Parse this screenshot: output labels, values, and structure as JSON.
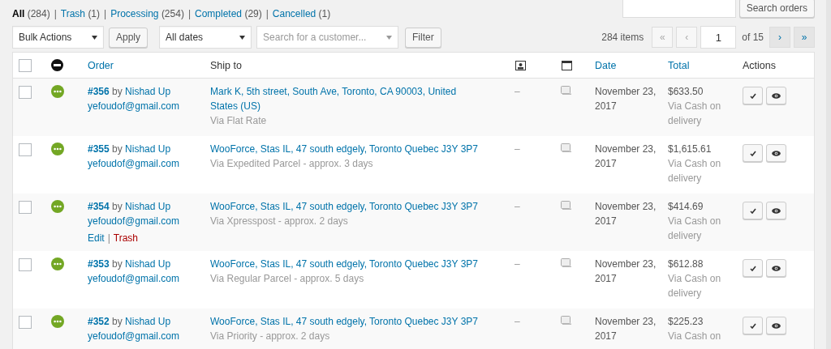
{
  "views": [
    {
      "label": "All",
      "count": "(284)",
      "selected": true
    },
    {
      "label": "Trash",
      "count": "(1)",
      "selected": false
    },
    {
      "label": "Processing",
      "count": "(254)",
      "selected": false
    },
    {
      "label": "Completed",
      "count": "(29)",
      "selected": false
    },
    {
      "label": "Cancelled",
      "count": "(1)",
      "selected": false
    }
  ],
  "view_separator": "|",
  "search": {
    "button": "Search orders"
  },
  "bulk_actions": {
    "value": "Bulk Actions",
    "apply": "Apply"
  },
  "date_filter": {
    "value": "All dates"
  },
  "customer_filter": {
    "placeholder": "Search for a customer..."
  },
  "filter_button": "Filter",
  "pagination": {
    "items": "284 items",
    "first": "«",
    "prev": "‹",
    "page": "1",
    "of": "of 15",
    "next": "›",
    "last": "»",
    "first_disabled": true,
    "prev_disabled": true,
    "next_disabled": false,
    "last_disabled": false
  },
  "table": {
    "select_all_checked": false,
    "columns": [
      {
        "kind": "status-icon"
      },
      {
        "kind": "text",
        "label": "Order",
        "sortable": true
      },
      {
        "kind": "text",
        "label": "Ship to",
        "sortable": false
      },
      {
        "kind": "billing-icon"
      },
      {
        "kind": "notes-icon"
      },
      {
        "kind": "text",
        "label": "Date",
        "sortable": true
      },
      {
        "kind": "text",
        "label": "Total",
        "sortable": true
      },
      {
        "kind": "text",
        "label": "Actions",
        "sortable": false
      }
    ],
    "rows": [
      {
        "checked": false,
        "color": "#73a724",
        "number": "#356",
        "by": "by",
        "customer": "Nishad Up",
        "email": "yefoudof@gmail.com",
        "address": "Mark K, 5th street, South Ave, Toronto, CA 90003, United States (US)",
        "method": "Via Flat Rate",
        "billing": "–",
        "date": "November 23, 2017",
        "total": "$633.50",
        "payment": "Via Cash on delivery",
        "row_actions": []
      },
      {
        "checked": false,
        "color": "#73a724",
        "number": "#355",
        "by": "by",
        "customer": "Nishad Up",
        "email": "yefoudof@gmail.com",
        "address": "WooForce, Stas IL, 47 south edgely, Toronto Quebec J3Y 3P7",
        "method": "Via Expedited Parcel - approx. 3 days",
        "billing": "–",
        "date": "November 23, 2017",
        "total": "$1,615.61",
        "payment": "Via Cash on delivery",
        "row_actions": []
      },
      {
        "checked": false,
        "color": "#73a724",
        "number": "#354",
        "by": "by",
        "customer": "Nishad Up",
        "email": "yefoudof@gmail.com",
        "address": "WooForce, Stas IL, 47 south edgely, Toronto Quebec J3Y 3P7",
        "method": "Via Xpresspost - approx. 2 days",
        "billing": "–",
        "date": "November 23, 2017",
        "total": "$414.69",
        "payment": "Via Cash on delivery",
        "row_actions": [
          {
            "kind": "edit",
            "label": "Edit"
          },
          {
            "kind": "separator",
            "label": "|"
          },
          {
            "kind": "trash",
            "label": "Trash"
          }
        ]
      },
      {
        "checked": false,
        "color": "#73a724",
        "number": "#353",
        "by": "by",
        "customer": "Nishad Up",
        "email": "yefoudof@gmail.com",
        "address": "WooForce, Stas IL, 47 south edgely, Toronto Quebec J3Y 3P7",
        "method": "Via Regular Parcel - approx. 5 days",
        "billing": "–",
        "date": "November 23, 2017",
        "total": "$612.88",
        "payment": "Via Cash on delivery",
        "row_actions": []
      },
      {
        "checked": false,
        "color": "#73a724",
        "number": "#352",
        "by": "by",
        "customer": "Nishad Up",
        "email": "yefoudof@gmail.com",
        "address": "WooForce, Stas IL, 47 south edgely, Toronto Quebec J3Y 3P7",
        "method": "Via Priority - approx. 2 days",
        "billing": "–",
        "date": "November 23, 2017",
        "total": "$225.23",
        "payment": "Via Cash on",
        "row_actions": []
      }
    ]
  }
}
